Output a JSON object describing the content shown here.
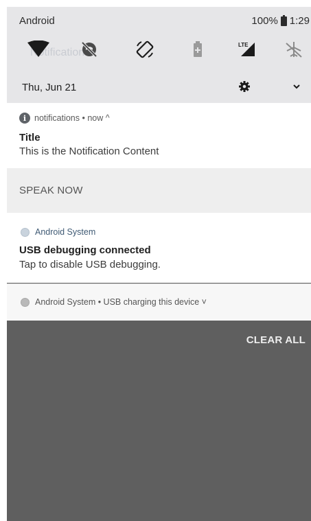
{
  "status_bar": {
    "carrier": "Android",
    "battery": "100%",
    "time": "1:29"
  },
  "quick_settings": {
    "ghost_text": "Notification",
    "tiles": [
      {
        "icon": "wifi-icon"
      },
      {
        "icon": "do-not-disturb-icon"
      },
      {
        "icon": "auto-rotate-icon"
      },
      {
        "icon": "battery-saver-icon"
      },
      {
        "icon": "lte-signal-icon"
      },
      {
        "icon": "airplane-mode-icon"
      }
    ],
    "date": "Thu, Jun 21",
    "settings_icon": "gear-icon",
    "expand_icon": "chevron-down-icon"
  },
  "notifications": [
    {
      "app": "notifications",
      "when": "now",
      "meta": "notifications • now ^",
      "title": "Title",
      "content": "This is the Notification Content"
    },
    {
      "app": "Android System",
      "title": "USB debugging connected",
      "content": "Tap to disable USB debugging."
    },
    {
      "summary": "Android System • USB charging this device ˅"
    }
  ],
  "speak_now": "SPEAK NOW",
  "clear_all": "CLEAR ALL",
  "colors": {
    "qs_background": "#e6e6e8",
    "shade_background": "#5f5f5f",
    "card_background": "#ffffff",
    "speak_background": "#eeeeee"
  }
}
